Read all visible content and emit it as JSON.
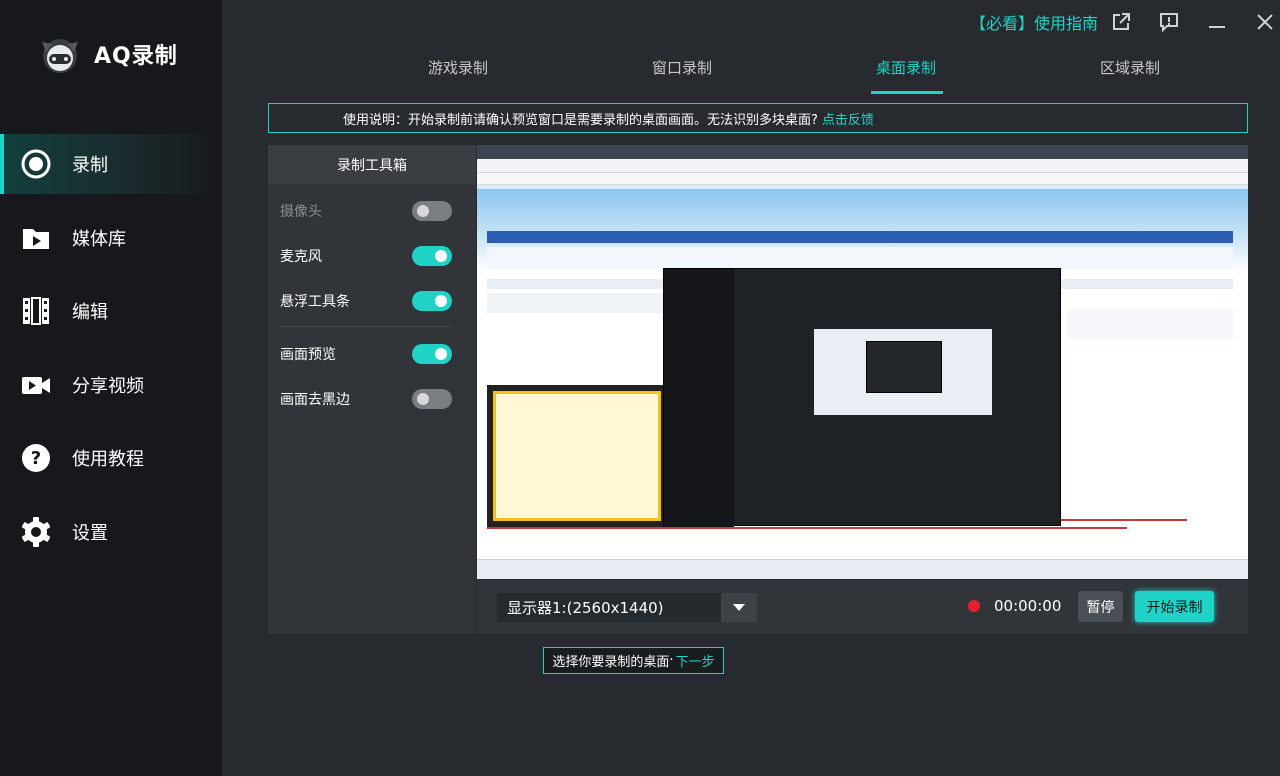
{
  "app": {
    "name": "AQ录制"
  },
  "sidebar": {
    "items": [
      {
        "label": "录制",
        "icon": "record-icon"
      },
      {
        "label": "媒体库",
        "icon": "media-library-icon"
      },
      {
        "label": "编辑",
        "icon": "edit-film-icon"
      },
      {
        "label": "分享视频",
        "icon": "share-video-icon"
      },
      {
        "label": "使用教程",
        "icon": "help-icon"
      },
      {
        "label": "设置",
        "icon": "settings-gear-icon"
      }
    ],
    "active_index": 0
  },
  "header": {
    "guide_label": "【必看】使用指南",
    "icons": [
      "external-link-icon",
      "feedback-icon",
      "minimize-icon",
      "close-icon"
    ]
  },
  "tabs": [
    {
      "label": "游戏录制"
    },
    {
      "label": "窗口录制"
    },
    {
      "label": "桌面录制"
    },
    {
      "label": "区域录制"
    }
  ],
  "active_tab": 2,
  "notice": {
    "text": "使用说明：开始录制前请确认预览窗口是需要录制的桌面画面。无法识别多块桌面?",
    "link": "点击反馈"
  },
  "toolbox": {
    "title": "录制工具箱",
    "items": [
      {
        "label": "摄像头",
        "on": false,
        "disabled": true
      },
      {
        "label": "麦克风",
        "on": true,
        "disabled": false
      },
      {
        "label": "悬浮工具条",
        "on": true,
        "disabled": false
      },
      {
        "label": "画面预览",
        "on": true,
        "disabled": false
      },
      {
        "label": "画面去黑边",
        "on": false,
        "disabled": false
      }
    ]
  },
  "controls": {
    "display_value": "显示器1:(2560x1440)",
    "timer": "00:00:00",
    "pause_label": "暂停",
    "start_label": "开始录制"
  },
  "hint": {
    "text": "选择你要录制的桌面",
    "sep": "·",
    "next": "下一步"
  },
  "colors": {
    "accent": "#1fd3c6",
    "sidebar_bg": "#16181b",
    "main_bg": "#272b30",
    "panel_bg": "#31353a",
    "record_dot": "#e5222a"
  }
}
